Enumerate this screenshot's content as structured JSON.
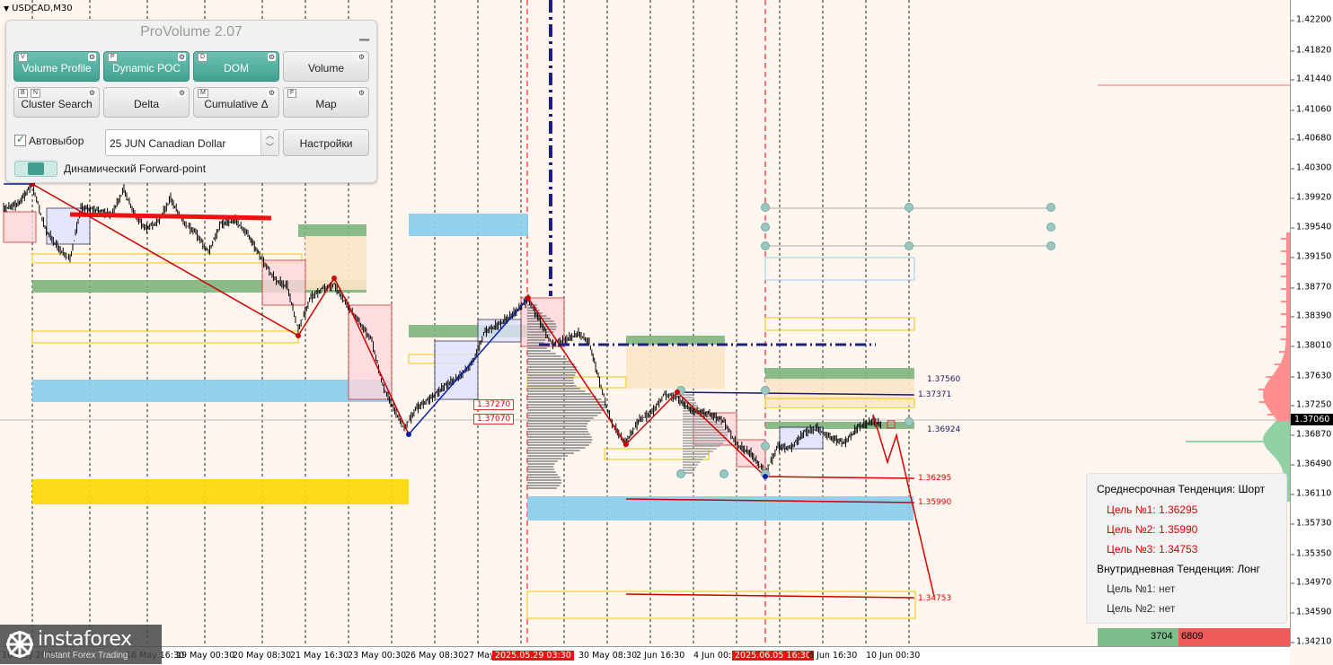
{
  "symbol": "USDCAD,M30",
  "panel": {
    "title": "ProVolume 2.07",
    "minimize_icon": "minimize-icon",
    "buttons": [
      {
        "label": "Volume Profile",
        "key": "V",
        "active": true
      },
      {
        "label": "Dynamic POC",
        "key": "P",
        "active": true
      },
      {
        "label": "DOM",
        "key": "D",
        "active": true
      },
      {
        "label": "Volume",
        "key": "",
        "active": false
      },
      {
        "label": "Cluster Search",
        "key": "B",
        "key2": "N",
        "active": false
      },
      {
        "label": "Delta",
        "key": "",
        "active": false
      },
      {
        "label": "Cumulative Δ",
        "key": "M",
        "active": false
      },
      {
        "label": "Map",
        "key": "F",
        "active": false
      }
    ],
    "autoselect_label": "Автовыбор",
    "autoselect_checked": true,
    "instrument_value": "25 JUN Canadian Dollar",
    "settings_label": "Настройки",
    "forward_point_label": "Динамический Forward-point"
  },
  "price_scale": [
    "1.42200",
    "1.41820",
    "1.41440",
    "1.41060",
    "1.40680",
    "1.40300",
    "1.39920",
    "1.39540",
    "1.39150",
    "1.38770",
    "1.38390",
    "1.38010",
    "1.37630",
    "1.37250",
    "1.36870",
    "1.36490",
    "1.36110",
    "1.35730",
    "1.35350",
    "1.34970",
    "1.34590",
    "1.34210"
  ],
  "current_price": "1.37060",
  "time_axis": [
    {
      "label": "16 May 2025",
      "highlight": false
    },
    {
      "label": "16 May 16:30",
      "highlight": false
    },
    {
      "label": "19 May 00:30",
      "highlight": false
    },
    {
      "label": "20 May 08:30",
      "highlight": false
    },
    {
      "label": "21 May 16:30",
      "highlight": false
    },
    {
      "label": "23 May 00:30",
      "highlight": false
    },
    {
      "label": "26 May 08:30",
      "highlight": false
    },
    {
      "label": "27 May",
      "highlight": false
    },
    {
      "label": "2025.05.29 03:30",
      "highlight": true
    },
    {
      "label": "30 May 08:30",
      "highlight": false
    },
    {
      "label": "2 Jun 16:30",
      "highlight": false
    },
    {
      "label": "4 Jun 00:30",
      "highlight": false
    },
    {
      "label": "2025.06.05 16:30",
      "highlight": true
    },
    {
      "label": "6 Jun 16:30",
      "highlight": false
    },
    {
      "label": "10 Jun 00:30",
      "highlight": false
    }
  ],
  "levels": {
    "l1": "1.37560",
    "l2": "1.37371",
    "l3": "1.36924",
    "t1": "1.36295",
    "t2": "1.35990",
    "t3": "1.34753",
    "box1": "1.37270",
    "box2": "1.37070"
  },
  "trend": {
    "mid_term": "Среднесрочная Тенденция: Шорт",
    "mid_targets": [
      "Цель №1: 1.36295",
      "Цель №2: 1.35990",
      "Цель №3: 1.34753"
    ],
    "intraday": "Внутридневная Тенденция: Лонг",
    "intraday_targets": [
      "Цель №1: нет",
      "Цель №2: нет"
    ]
  },
  "delta": {
    "buy": "3704",
    "sell": "6809"
  },
  "watermark": {
    "brand": "instaforex",
    "tagline": "Instant Forex Trading"
  },
  "colors": {
    "background": "#fff6ef",
    "bull_zone": "#7db57d",
    "bear_zone": "#87ceeb",
    "level_yellow": "#ffd700",
    "trend_red": "#d00000",
    "trend_blue": "#0a1fa8"
  }
}
